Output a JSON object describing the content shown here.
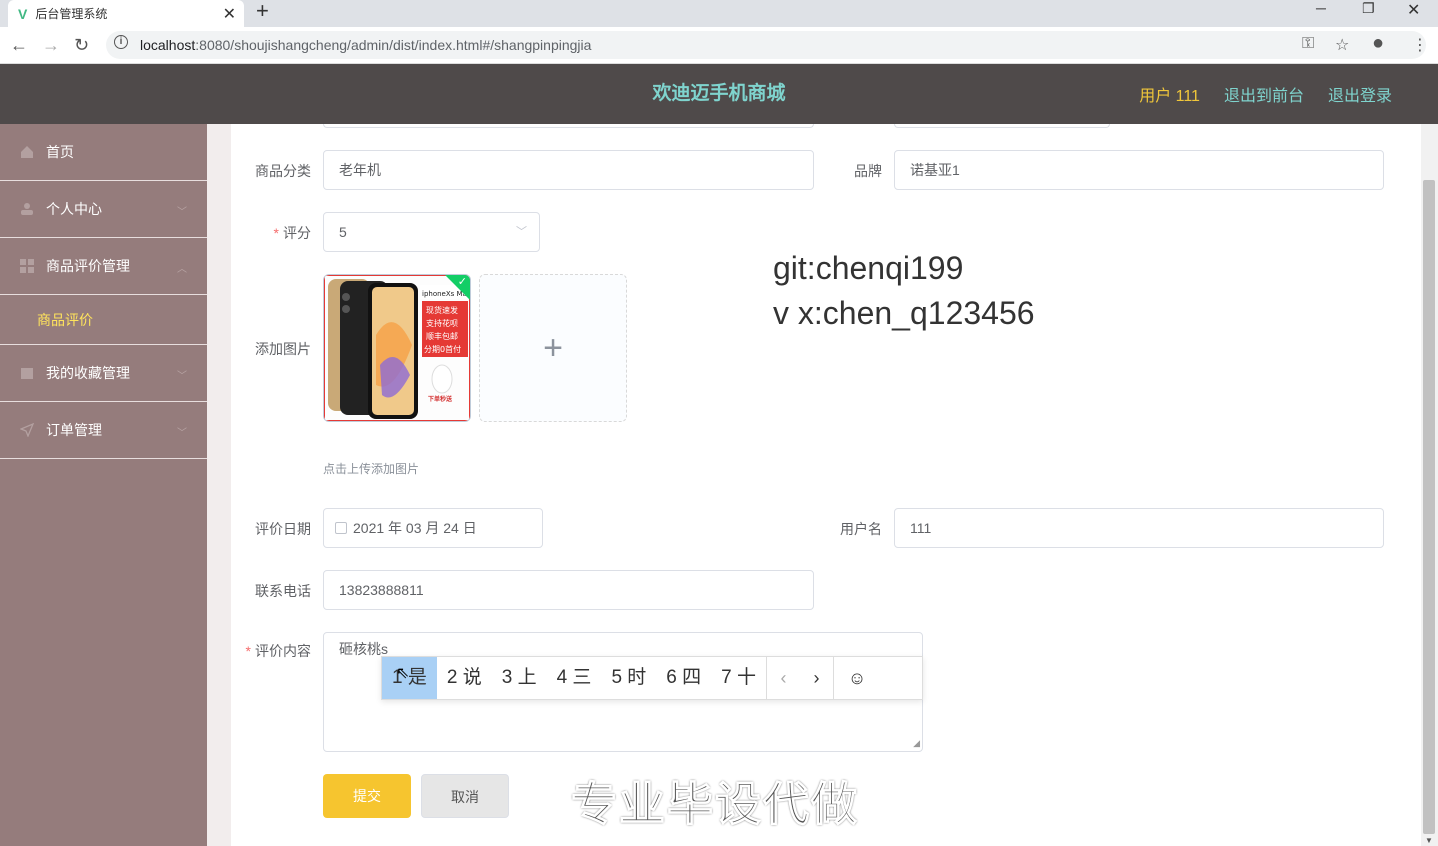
{
  "browser": {
    "tab_title": "后台管理系统",
    "url_host": "localhost",
    "url_path": ":8080/shoujishangcheng/admin/dist/index.html#/shangpinpingjia"
  },
  "header": {
    "title": "欢迪迈手机商城",
    "user_label": "用户 111",
    "back_label": "退出到前台",
    "logout_label": "退出登录"
  },
  "sidebar": {
    "items": [
      {
        "label": "首页"
      },
      {
        "label": "个人中心"
      },
      {
        "label": "商品评价管理"
      },
      {
        "label": "商品评价"
      },
      {
        "label": "我的收藏管理"
      },
      {
        "label": "订单管理"
      }
    ]
  },
  "form": {
    "category_label": "商品分类",
    "category_value": "老年机",
    "brand_label": "品牌",
    "brand_value": "诺基亚1",
    "score_label": "评分",
    "score_value": "5",
    "image_label": "添加图片",
    "upload_tip": "点击上传添加图片",
    "date_label": "评价日期",
    "date_value": "2021 年 03 月 24 日",
    "username_label": "用户名",
    "username_value": "111",
    "phone_label": "联系电话",
    "phone_value": "13823888811",
    "content_label": "评价内容",
    "content_value": "砸核桃s",
    "submit_label": "提交",
    "cancel_label": "取消"
  },
  "product_image": {
    "model": "iphoneXs Max",
    "lines": [
      "现货速发",
      "支持花呗",
      "顺丰包邮",
      "分期0首付"
    ],
    "footer": "下单秒送"
  },
  "ime": {
    "candidates": [
      "1 是",
      "2 说",
      "3 上",
      "4 三",
      "5 时",
      "6 四",
      "7 十"
    ]
  },
  "overlay": {
    "watermark_line1": "git:chenqi199",
    "watermark_line2": "v x:chen_q123456",
    "watermark_big": "专业毕设代做"
  },
  "colors": {
    "header_bg": "#4f4a4a",
    "sidebar_bg": "#957c7c",
    "accent_teal": "#7fd4ce",
    "accent_yellow": "#f6c52f"
  }
}
